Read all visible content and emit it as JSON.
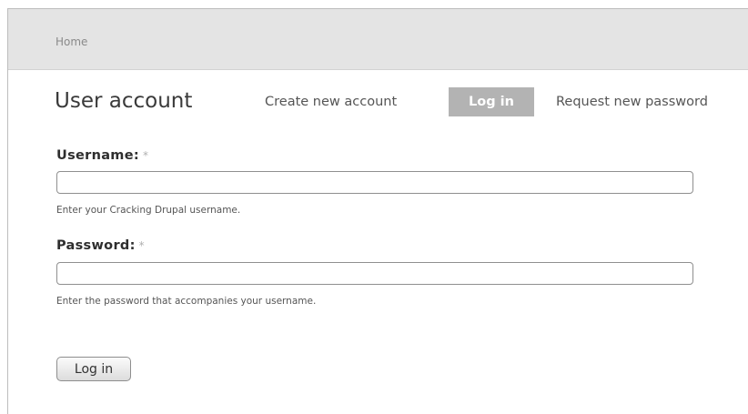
{
  "breadcrumb": {
    "home": "Home"
  },
  "page": {
    "title": "User account"
  },
  "tabs": [
    {
      "label": "Create new account",
      "active": false
    },
    {
      "label": "Log in",
      "active": true
    },
    {
      "label": "Request new password",
      "active": false
    }
  ],
  "form": {
    "username": {
      "label": "Username:",
      "required_mark": "*",
      "value": "",
      "description": "Enter your Cracking Drupal username."
    },
    "password": {
      "label": "Password:",
      "required_mark": "*",
      "value": "",
      "description": "Enter the password that accompanies your username."
    },
    "submit_label": "Log in"
  },
  "colors": {
    "header_bg": "#e4e4e4",
    "active_tab_bg": "#b3b3b3",
    "active_tab_text": "#ffffff"
  }
}
